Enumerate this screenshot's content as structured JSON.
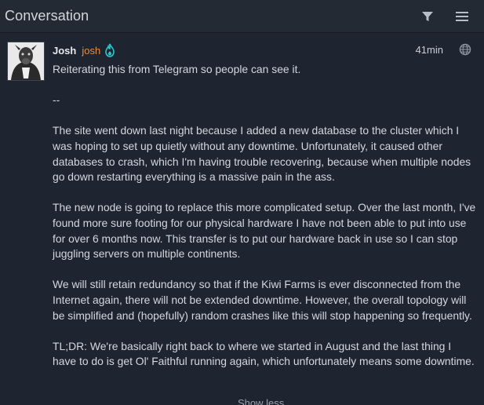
{
  "header": {
    "title": "Conversation",
    "filter_icon": "filter-icon",
    "menu_icon": "hamburger-menu-icon"
  },
  "post": {
    "author": "Josh",
    "handle": "josh",
    "badge_icon": "flame-icon",
    "time": "41min",
    "visibility_icon": "globe-icon",
    "paragraphs": [
      "Reiterating this from Telegram so people can see it.",
      "--",
      "The site went down last night because I added a new database to the cluster which I was hoping to set up quietly without any downtime. Unfortunately, it caused other databases to crash, which I'm having trouble recovering, because when multiple nodes go down restarting everything is a massive pain in the ass.",
      "The new node is going to replace this more complicated setup. Over the last month, I've found more sure footing for our physical hardware I have not been able to put into use for over 6 months now. This transfer is to put our hardware back in use so I can stop juggling servers on multiple continents.",
      "We will still retain redundancy so that if the Kiwi Farms is ever disconnected from the Internet again, there will not be extended downtime. However, the overall topology will be simplified and (hopefully) random crashes like this will stop happening so frequently.",
      "TL;DR: We're basically right back to where we started in August and the last thing I have to do is get Ol' Faithful running again, which unfortunately means some downtime."
    ],
    "show_more": "Show less"
  },
  "colors": {
    "background": "#1e2430",
    "header_bg": "#232a34",
    "handle": "#e88e41",
    "badge": "#26c6c9",
    "text": "#d3d8de"
  }
}
